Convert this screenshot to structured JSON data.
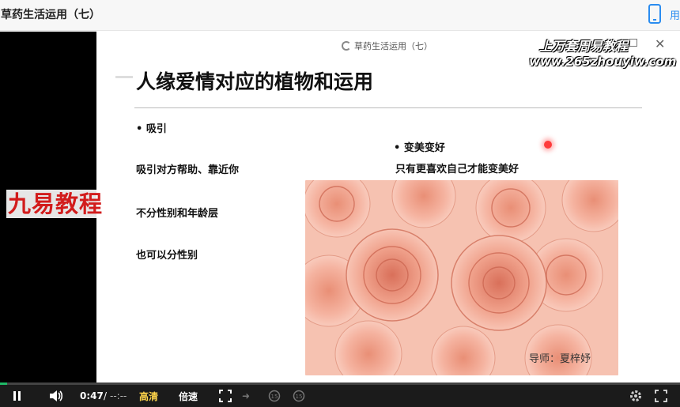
{
  "window": {
    "title": "草药生活运用（七）",
    "side_text": "用"
  },
  "player": {
    "slide_header": "草药生活运用（七）",
    "watermarks": {
      "left": "九易教程",
      "right_line1": "上万套周易教程",
      "right_line2": "www.265zhouyiw.com"
    },
    "slide": {
      "title": "人缘爱情对应的植物和运用",
      "left_bullet": "吸引",
      "left_lines": [
        "吸引对方帮助、靠近你",
        "不分性别和年龄层",
        "也可以分性别"
      ],
      "right_bullet": "变美变好",
      "right_line": "只有更喜欢自己才能变美好",
      "photo_caption": "导师：夏梓妤"
    },
    "controls": {
      "current_time": "0:47",
      "separator": "/",
      "total_time": "--:--",
      "quality": "高清",
      "speed": "倍速"
    },
    "progress_percent": 1,
    "icons": [
      "pause-icon",
      "volume-icon",
      "fit-screen-icon",
      "next-icon",
      "back-15-icon",
      "forward-15-icon",
      "settings-icon",
      "fullscreen-icon",
      "phone-icon",
      "close-icon",
      "loading-icon"
    ]
  }
}
